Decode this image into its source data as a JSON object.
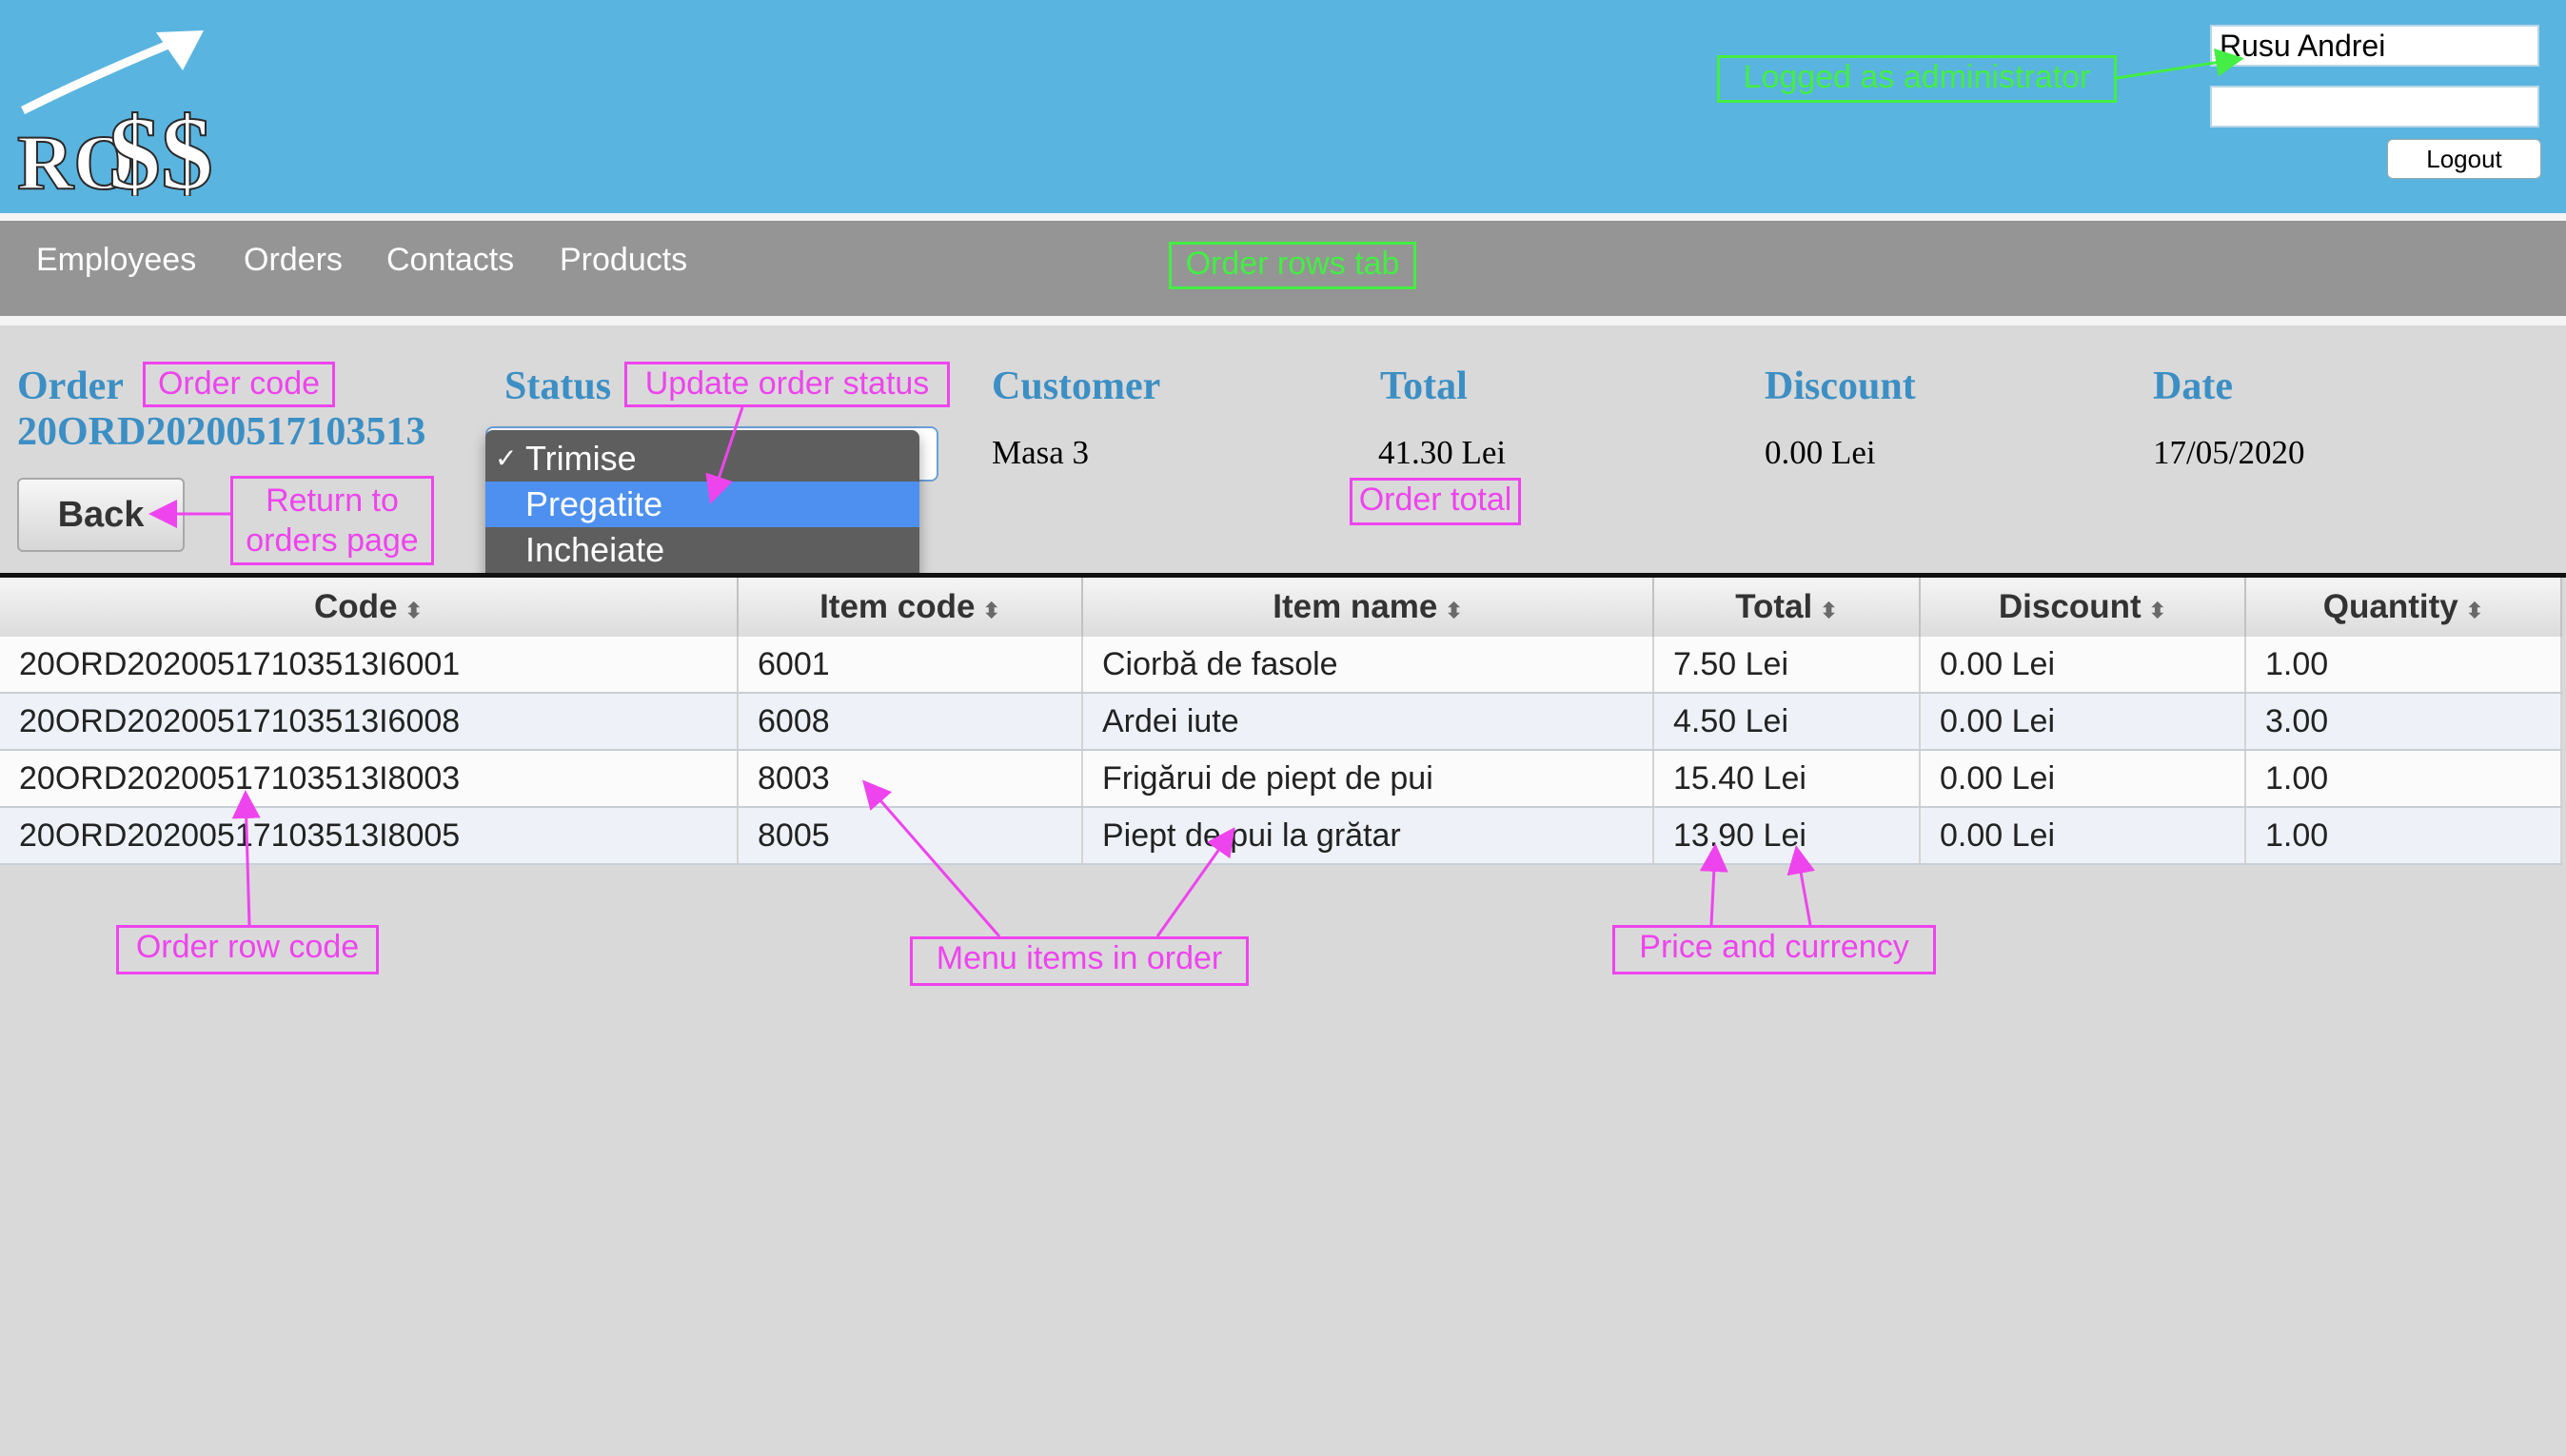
{
  "header": {
    "logo_text": "RO$$",
    "user_name": "Rusu Andrei",
    "user_second_field": "",
    "logout_label": "Logout"
  },
  "nav": {
    "items": [
      {
        "label": "Employees"
      },
      {
        "label": "Orders"
      },
      {
        "label": "Contacts"
      },
      {
        "label": "Products"
      }
    ]
  },
  "order": {
    "order_label": "Order",
    "order_code": "20ORD20200517103513",
    "back_label": "Back",
    "status_label": "Status",
    "status_options": [
      {
        "label": "Trimise",
        "checked": true,
        "highlighted": false
      },
      {
        "label": "Pregatite",
        "checked": false,
        "highlighted": true
      },
      {
        "label": "Incheiate",
        "checked": false,
        "highlighted": false
      }
    ],
    "check_mark": "✓",
    "customer_label": "Customer",
    "customer_value": "Masa 3",
    "total_label": "Total",
    "total_value": "41.30 Lei",
    "discount_label": "Discount",
    "discount_value": "0.00 Lei",
    "date_label": "Date",
    "date_value": "17/05/2020"
  },
  "table": {
    "sort_glyph": "⬍",
    "columns": [
      "Code",
      "Item code",
      "Item name",
      "Total",
      "Discount",
      "Quantity"
    ],
    "rows": [
      [
        "20ORD20200517103513I6001",
        "6001",
        "Ciorbă de fasole",
        "7.50 Lei",
        "0.00 Lei",
        "1.00"
      ],
      [
        "20ORD20200517103513I6008",
        "6008",
        "Ardei iute",
        "4.50 Lei",
        "0.00 Lei",
        "3.00"
      ],
      [
        "20ORD20200517103513I8003",
        "8003",
        "Frigărui de piept de pui",
        "15.40 Lei",
        "0.00 Lei",
        "1.00"
      ],
      [
        "20ORD20200517103513I8005",
        "8005",
        "Piept de pui la grătar",
        "13.90 Lei",
        "0.00 Lei",
        "1.00"
      ]
    ]
  },
  "annotations": {
    "logged_as_admin": "Logged as administrator",
    "order_rows_tab": "Order rows tab",
    "order_code": "Order code",
    "update_status": "Update order status",
    "return_line1": "Return to",
    "return_line2": "orders page",
    "order_total": "Order total",
    "order_row_code": "Order row code",
    "menu_items": "Menu items in order",
    "price_currency": "Price and currency"
  },
  "colors": {
    "header_bg": "#5ab4e0",
    "nav_bg": "#959595",
    "label_blue": "#3c8fc4",
    "annotation_magenta": "#ee44ee",
    "annotation_green": "#44ee44",
    "dropdown_highlight": "#4e90f0"
  }
}
